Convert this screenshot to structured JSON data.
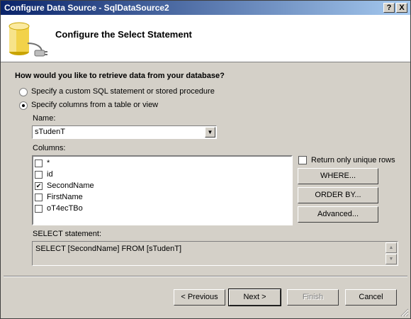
{
  "window": {
    "title": "Configure Data Source - SqlDataSource2"
  },
  "titlebar_buttons": {
    "help": "?",
    "close": "X"
  },
  "header": {
    "title": "Configure the Select Statement",
    "icon": "database-plug-icon"
  },
  "question": "How would you like to retrieve data from your database?",
  "options": [
    {
      "label": "Specify a custom SQL statement or stored procedure",
      "selected": false
    },
    {
      "label": "Specify columns from a table or view",
      "selected": true
    }
  ],
  "name_label": "Name:",
  "table_name": "sTudenT",
  "columns_label": "Columns:",
  "columns": [
    {
      "name": "*",
      "checked": false
    },
    {
      "name": "id",
      "checked": false
    },
    {
      "name": "SecondName",
      "checked": true
    },
    {
      "name": "FirstName",
      "checked": false
    },
    {
      "name": "oT4ecTBo",
      "checked": false
    }
  ],
  "unique_rows": {
    "label": "Return only unique rows",
    "checked": false
  },
  "side_buttons": {
    "where": "WHERE...",
    "order_by": "ORDER BY...",
    "advanced": "Advanced..."
  },
  "select_label": "SELECT statement:",
  "select_statement": "SELECT [SecondName] FROM [sTudenT]",
  "footer": {
    "previous": "< Previous",
    "next": "Next >",
    "finish": "Finish",
    "cancel": "Cancel"
  }
}
